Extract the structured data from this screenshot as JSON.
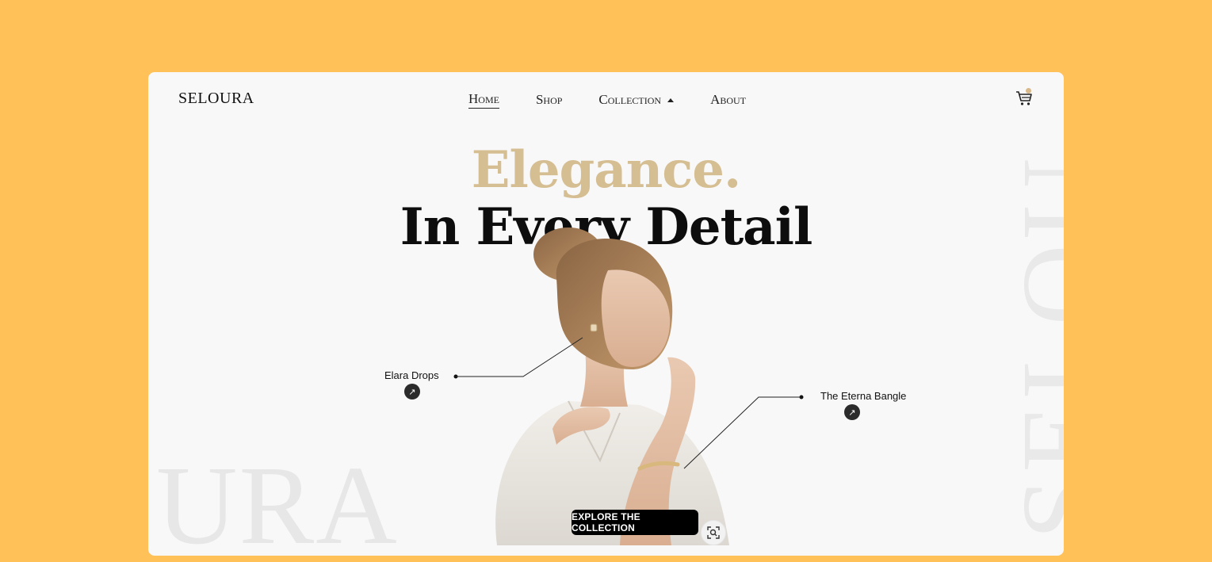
{
  "brand": {
    "name": "SELOURA"
  },
  "nav": {
    "items": [
      {
        "label": "Home",
        "active": true
      },
      {
        "label": "Shop",
        "active": false
      },
      {
        "label": "Collection",
        "active": false,
        "has_dropdown": true
      },
      {
        "label": "About",
        "active": false
      }
    ],
    "cart_icon": "cart-icon"
  },
  "hero": {
    "headline_accent": "Elegance.",
    "headline_main": "In Every Detail",
    "watermark_bottom": "URA",
    "watermark_side": "SELOU",
    "cta_label": "EXPLORE THE COLLECTION",
    "scan_icon": "scan-search-icon"
  },
  "callouts": [
    {
      "label": "Elara Drops",
      "icon": "arrow-up-right-icon"
    },
    {
      "label": "The Eterna Bangle",
      "icon": "arrow-up-right-icon"
    }
  ],
  "colors": {
    "background": "#FFC158",
    "card": "#F8F8F8",
    "accent": "#D6BE93",
    "text": "#0D0D0D"
  }
}
